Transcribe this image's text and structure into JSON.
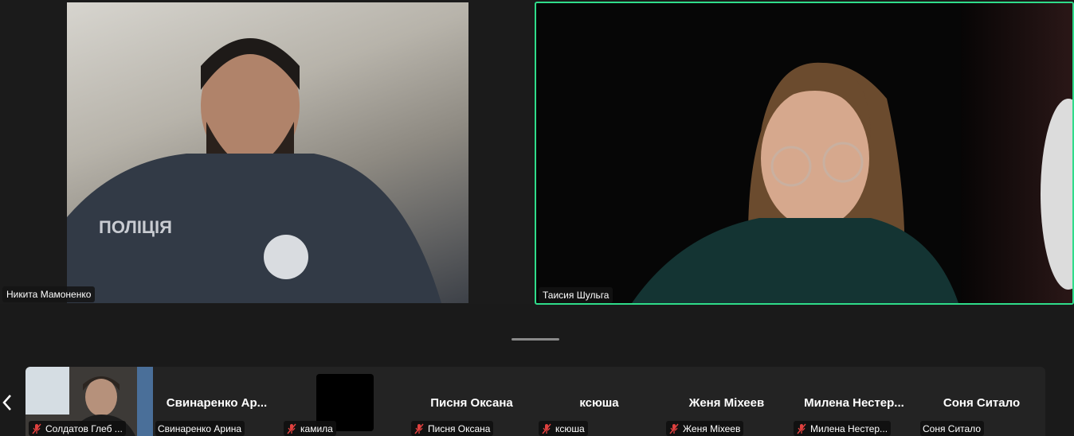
{
  "tiles": [
    {
      "name": "Никита Мамоненко",
      "active": false
    },
    {
      "name": "Таисия Шульга",
      "active": true
    }
  ],
  "colors": {
    "active_border": "#2fdc8a",
    "muted_mic": "#e0413f"
  },
  "strip": [
    {
      "title": "",
      "label": "Солдатов Глеб ...",
      "muted": true
    },
    {
      "title": "Свинаренко  Ар...",
      "label": "Свинаренко Арина",
      "muted": false
    },
    {
      "title": "",
      "label": "камила",
      "muted": true
    },
    {
      "title": "Писня Оксана",
      "label": "Писня Оксана",
      "muted": true
    },
    {
      "title": "ксюша",
      "label": "ксюша",
      "muted": true
    },
    {
      "title": "Женя Міхеев",
      "label": "Женя Міхеев",
      "muted": true
    },
    {
      "title": "Милена  Нестер...",
      "label": "Милена Нестер...",
      "muted": true
    },
    {
      "title": "Соня Ситало",
      "label": "Соня Ситало",
      "muted": false
    }
  ]
}
